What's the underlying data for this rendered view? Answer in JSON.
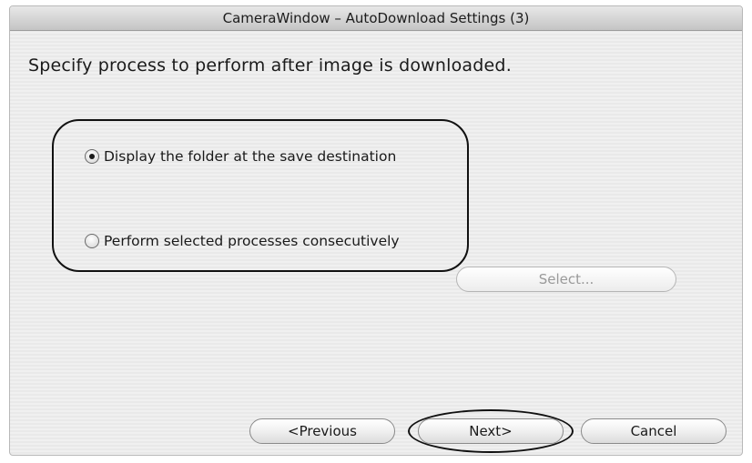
{
  "window": {
    "title": "CameraWindow – AutoDownload Settings (3)"
  },
  "instruction": "Specify process to perform after image is downloaded.",
  "options": [
    {
      "label": "Display the folder at the save destination",
      "selected": true
    },
    {
      "label": "Perform selected processes consecutively",
      "selected": false
    }
  ],
  "buttons": {
    "select": "Select...",
    "previous": "<Previous",
    "next": "Next>",
    "cancel": "Cancel"
  },
  "colors": {
    "window_bg": "#f0f0f0",
    "callout": "#111111",
    "disabled_text": "#9a9a9a"
  }
}
